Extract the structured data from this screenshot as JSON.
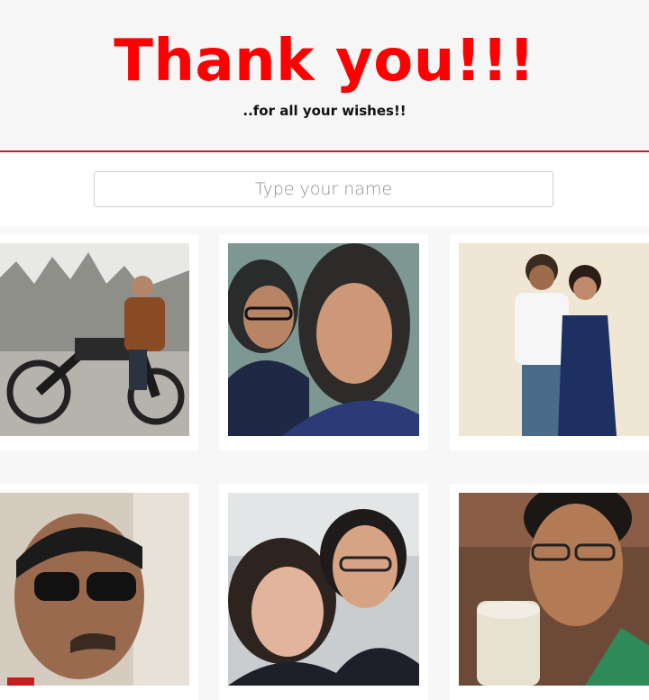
{
  "header": {
    "title": "Thank you!!!",
    "subtitle": "..for all your wishes!!"
  },
  "search": {
    "placeholder": "Type your name",
    "value": ""
  },
  "colors": {
    "accent": "#ff0000",
    "divider": "#d21c1c",
    "background": "#f7f7f7"
  },
  "gallery": {
    "photos": [
      {
        "icon": "photo-man-motorcycle",
        "alt": "man riding motorcycle"
      },
      {
        "icon": "photo-two-women-selfie",
        "alt": "two women selfie"
      },
      {
        "icon": "photo-couple-standing",
        "alt": "couple standing"
      },
      {
        "icon": "photo-man-sunglasses",
        "alt": "man with sunglasses"
      },
      {
        "icon": "photo-couple-airplane",
        "alt": "couple on airplane"
      },
      {
        "icon": "photo-man-glasses-mug",
        "alt": "man with glasses holding mug"
      }
    ]
  }
}
